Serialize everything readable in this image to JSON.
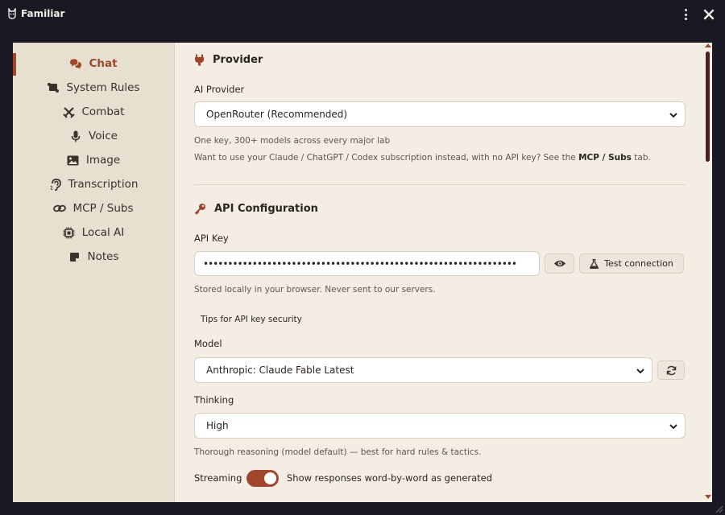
{
  "window": {
    "title": "Familiar",
    "menu_icon": "more-vertical-icon",
    "close_icon": "close-icon"
  },
  "sidebar": {
    "items": [
      {
        "label": "Chat",
        "icon": "chat-bubbles-icon",
        "active": true
      },
      {
        "label": "System Rules",
        "icon": "scroll-icon"
      },
      {
        "label": "Combat",
        "icon": "crossed-swords-icon"
      },
      {
        "label": "Voice",
        "icon": "microphone-icon"
      },
      {
        "label": "Image",
        "icon": "image-icon"
      },
      {
        "label": "Transcription",
        "icon": "ear-icon"
      },
      {
        "label": "MCP / Subs",
        "icon": "link-icon"
      },
      {
        "label": "Local AI",
        "icon": "chip-icon"
      },
      {
        "label": "Notes",
        "icon": "note-icon"
      }
    ]
  },
  "provider": {
    "heading": "Provider",
    "icon": "plug-icon",
    "field_label": "AI Provider",
    "selected": "OpenRouter (Recommended)",
    "help1": "One key, 300+ models across every major lab",
    "help2_prefix": "Want to use your Claude / ChatGPT / Codex subscription instead, with no API key? See the",
    "help2_link": "MCP / Subs",
    "help2_suffix": "tab."
  },
  "api": {
    "heading": "API Configuration",
    "icon": "key-icon",
    "key_label": "API Key",
    "key_value": "••••••••••••••••••••••••••••••••••••••••••••••••••••••••••••••••",
    "reveal_icon": "eye-icon",
    "test_label": "Test connection",
    "test_icon": "flask-icon",
    "key_help": "Stored locally in your browser. Never sent to our servers.",
    "tips_label": "Tips for API key security",
    "model_label": "Model",
    "model_selected": "Anthropic: Claude Fable Latest",
    "refresh_icon": "refresh-icon",
    "thinking_label": "Thinking",
    "thinking_selected": "High",
    "thinking_help": "Thorough reasoning (model default) — best for hard rules & tactics.",
    "streaming_label": "Streaming",
    "streaming_on": true,
    "streaming_help": "Show responses word-by-word as generated"
  },
  "colors": {
    "accent": "#a0462d",
    "background": "#f3ede3",
    "sidebar": "#e7dfd0",
    "titlebar": "#1a1822"
  }
}
